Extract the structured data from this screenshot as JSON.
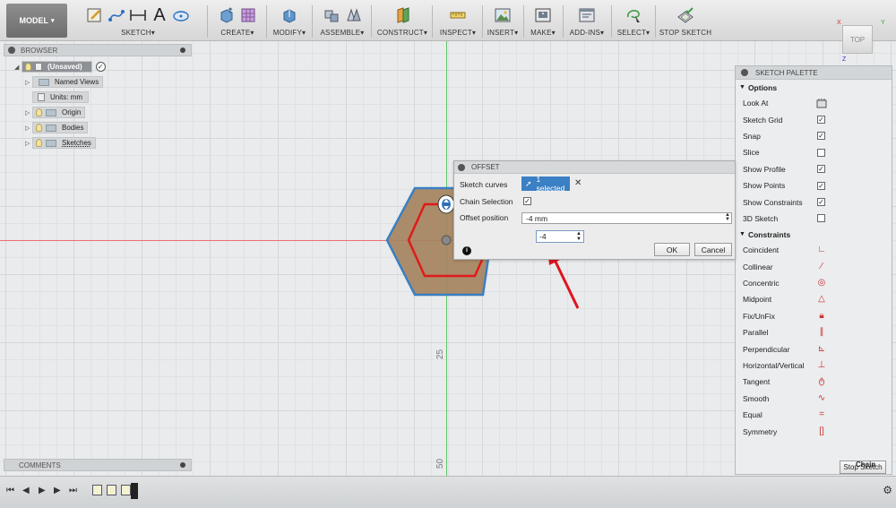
{
  "toolbar": {
    "workspace": "MODEL",
    "groups": {
      "sketch": "SKETCH",
      "create": "CREATE",
      "modify": "MODIFY",
      "assemble": "ASSEMBLE",
      "construct": "CONSTRUCT",
      "inspect": "INSPECT",
      "insert": "INSERT",
      "make": "MAKE",
      "addins": "ADD-INS",
      "select": "SELECT",
      "stop": "STOP SKETCH"
    },
    "sketch_text_glyph": "A",
    "caret": "▾"
  },
  "viewcube": {
    "face": "TOP",
    "axis_x": "X",
    "axis_y": "Y",
    "axis_z": "Z"
  },
  "browser": {
    "title": "BROWSER",
    "items": [
      {
        "label": "(Unsaved)"
      },
      {
        "label": "Named Views"
      },
      {
        "label": "Units: mm"
      },
      {
        "label": "Origin"
      },
      {
        "label": "Bodies"
      },
      {
        "label": "Sketches"
      }
    ]
  },
  "comments": {
    "title": "COMMENTS"
  },
  "ruler": {
    "mark_25": "25",
    "mark_50": "50"
  },
  "palette": {
    "title": "SKETCH PALETTE",
    "options_title": "Options",
    "options": [
      {
        "label": "Look At",
        "control": "icon"
      },
      {
        "label": "Sketch Grid",
        "control": "checkbox",
        "checked": true
      },
      {
        "label": "Snap",
        "control": "checkbox",
        "checked": true
      },
      {
        "label": "Slice",
        "control": "checkbox",
        "checked": false
      },
      {
        "label": "Show Profile",
        "control": "checkbox",
        "checked": true
      },
      {
        "label": "Show Points",
        "control": "checkbox",
        "checked": true
      },
      {
        "label": "Show Constraints",
        "control": "checkbox",
        "checked": true
      },
      {
        "label": "3D Sketch",
        "control": "checkbox",
        "checked": false
      }
    ],
    "constraints_title": "Constraints",
    "constraints": [
      "Coincident",
      "Collinear",
      "Concentric",
      "Midpoint",
      "Fix/UnFix",
      "Parallel",
      "Perpendicular",
      "Horizontal/Vertical",
      "Tangent",
      "Smooth",
      "Equal",
      "Symmetry"
    ],
    "stop_button": "Stop Sketch",
    "stop_button_overlay": "Chain"
  },
  "offset_dialog": {
    "title": "OFFSET",
    "sketch_curves_label": "Sketch curves",
    "selected_text": "1 selected",
    "clear_glyph": "✕",
    "chain_label": "Chain Selection",
    "chain_checked": true,
    "offset_position_label": "Offset position",
    "offset_position_value": "-4 mm",
    "ok": "OK",
    "cancel": "Cancel",
    "info_glyph": "i"
  },
  "floating_input": {
    "value": "-4"
  },
  "colors": {
    "accent_blue": "#3b7fc4",
    "hexagon_fill": "#a4825c",
    "offset_red": "#e01a1a",
    "x_axis": "#ee6f6f",
    "y_axis": "#62c36a"
  }
}
